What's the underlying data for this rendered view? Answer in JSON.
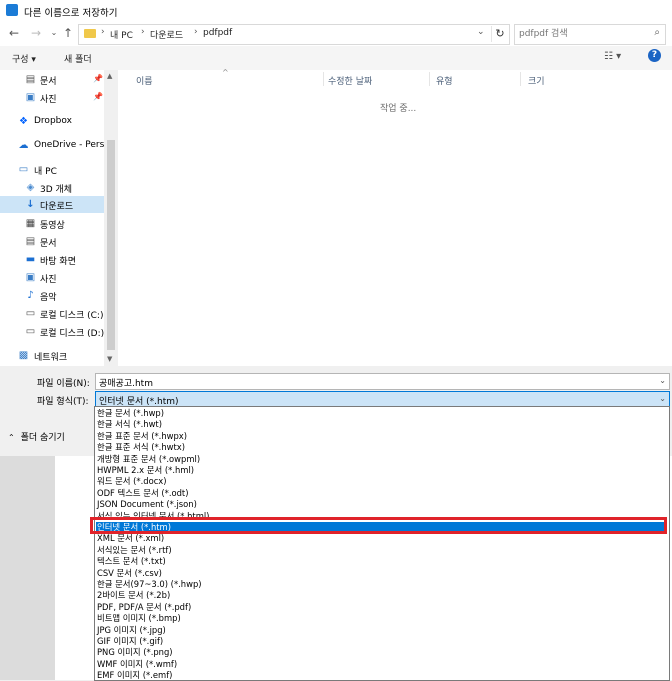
{
  "window": {
    "title": "다른 이름으로 저장하기"
  },
  "address": {
    "crumbs": [
      "내 PC",
      "다운로드",
      "pdfpdf"
    ],
    "search_placeholder": "pdfpdf 검색"
  },
  "toolbar": {
    "organize_label": "구성 ▾",
    "new_folder_label": "새 폴더"
  },
  "nav": {
    "items": [
      {
        "label": "문서",
        "icon": "document-icon"
      },
      {
        "label": "사진",
        "icon": "picture-icon"
      },
      {
        "label": "Dropbox",
        "icon": "dropbox-icon"
      },
      {
        "label": "OneDrive - Perso",
        "icon": "cloud-icon"
      },
      {
        "label": "내 PC",
        "icon": "computer-icon"
      },
      {
        "label": "3D 개체",
        "icon": "cube-icon"
      },
      {
        "label": "다운로드",
        "icon": "download-icon"
      },
      {
        "label": "동영상",
        "icon": "video-icon"
      },
      {
        "label": "문서",
        "icon": "document-icon"
      },
      {
        "label": "바탕 화면",
        "icon": "desktop-icon"
      },
      {
        "label": "사진",
        "icon": "picture-icon"
      },
      {
        "label": "음악",
        "icon": "music-icon"
      },
      {
        "label": "로컬 디스크 (C:)",
        "icon": "drive-icon"
      },
      {
        "label": "로컬 디스크 (D:)",
        "icon": "drive-icon"
      },
      {
        "label": "네트워크",
        "icon": "network-icon"
      }
    ]
  },
  "filelist": {
    "columns": [
      "이름",
      "수정한 날짜",
      "유형",
      "크기"
    ],
    "status": "작업 중..."
  },
  "form": {
    "filename_label": "파일 이름(N):",
    "filename_value": "공매공고.htm",
    "filetype_label": "파일 형식(T):",
    "filetype_value": "인터넷 문서 (*.htm)",
    "hide_folders_label": "폴더 숨기기"
  },
  "dropdown": {
    "selected_index": 10,
    "options": [
      "한글 문서 (*.hwp)",
      "한글 서식 (*.hwt)",
      "한글 표준 문서 (*.hwpx)",
      "한글 표준 서식 (*.hwtx)",
      "개방형 표준 문서 (*.owpml)",
      "HWPML 2.x 문서 (*.hml)",
      "워드 문서 (*.docx)",
      "ODF 텍스트 문서 (*.odt)",
      "JSON Document (*.json)",
      "서식 있는 인터넷 문서 (*.html)",
      "인터넷 문서 (*.htm)",
      "XML 문서 (*.xml)",
      "서식있는 문서 (*.rtf)",
      "텍스트 문서 (*.txt)",
      "CSV 문서 (*.csv)",
      "한글 문서(97~3.0) (*.hwp)",
      "2바이트 문서 (*.2b)",
      "PDF, PDF/A 문서 (*.pdf)",
      "비트맵 이미지 (*.bmp)",
      "JPG 이미지 (*.jpg)",
      "GIF 이미지 (*.gif)",
      "PNG 이미지 (*.png)",
      "WMF 이미지 (*.wmf)",
      "EMF 이미지 (*.emf)"
    ]
  },
  "colors": {
    "accent": "#0078d7",
    "highlight_border": "#e0232a",
    "selected_bg": "#cce4f7"
  }
}
